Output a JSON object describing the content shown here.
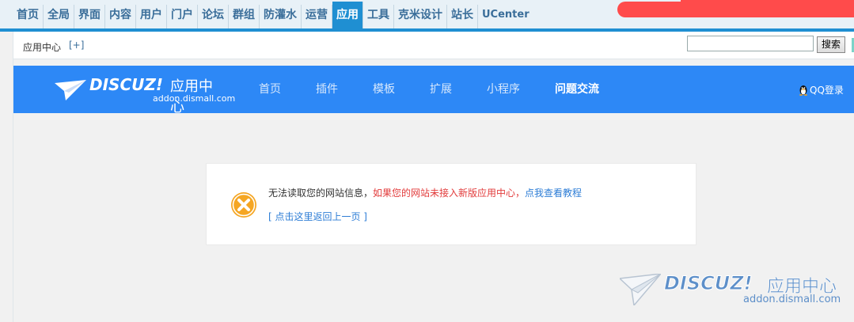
{
  "topnav": {
    "items": [
      "首页",
      "全局",
      "界面",
      "内容",
      "用户",
      "门户",
      "论坛",
      "群组",
      "防灌水",
      "运营",
      "应用",
      "工具",
      "克米设计",
      "站长",
      "UCenter"
    ],
    "active_index": 10
  },
  "subbar": {
    "title": "应用中心",
    "plus": "[+]",
    "search_value": "",
    "search_button": "搜索"
  },
  "header": {
    "brand": "DISCUZ!",
    "brand_cn": "应用中心",
    "domain": "addon.dismall.com",
    "nav": [
      "首页",
      "插件",
      "模板",
      "扩展",
      "小程序",
      "问题交流"
    ],
    "qq_login": "QQ登录"
  },
  "message": {
    "part1": "无法读取您的网站信息，",
    "part2": "如果您的网站未接入新版应用中心，",
    "part3": "点我查看教程",
    "back_link": "[ 点击这里返回上一页 ]"
  },
  "watermark": {
    "brand": "DISCUZ!",
    "brand_cn": "应用中心",
    "domain": "addon.dismall.com"
  },
  "colors": {
    "header_blue": "#2d88f6",
    "active_tab": "#1f8fd2",
    "error_orange": "#f5a623",
    "error_red_text": "#e23b3b",
    "link_blue": "#2d7dd6"
  }
}
